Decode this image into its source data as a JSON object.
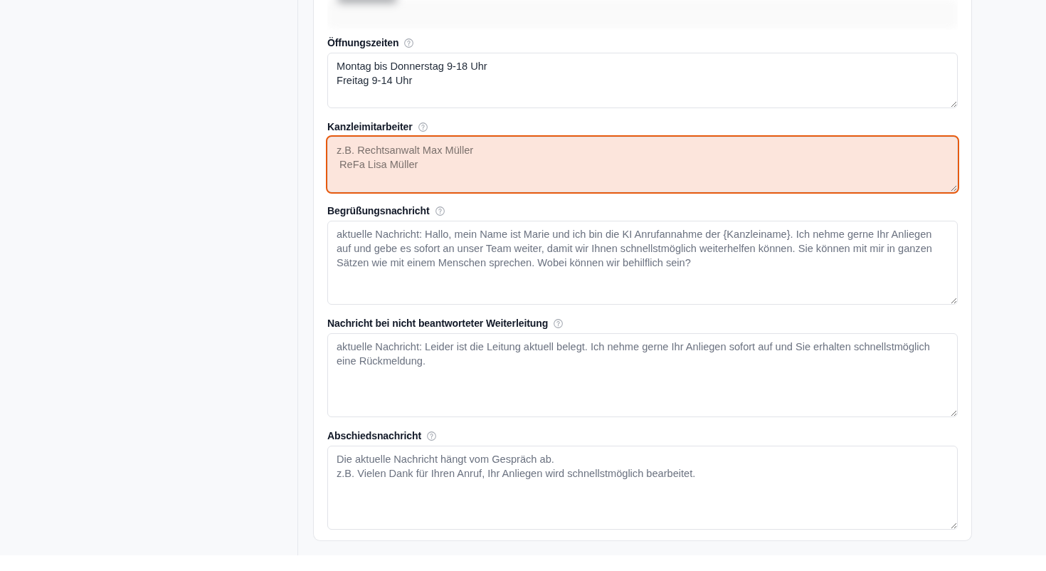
{
  "fields": [
    {
      "label": "Öffnungszeiten",
      "value": "Montag bis Donnerstag 9-18 Uhr\nFreitag 9-14 Uhr",
      "highlighted": false
    },
    {
      "label": "Kanzleimitarbeiter",
      "placeholder": "z.B. Rechtsanwalt Max Müller\n ReFa Lisa Müller",
      "highlighted": true
    },
    {
      "label": "Begrüßungsnachricht",
      "placeholder": "aktuelle Nachricht: Hallo, mein Name ist Marie und ich bin die KI Anrufannahme der {Kanzleiname}. Ich nehme gerne Ihr Anliegen auf und gebe es sofort an unser Team weiter, damit wir Ihnen schnellstmöglich weiterhelfen können. Sie können mit mir in ganzen Sätzen wie mit einem Menschen sprechen. Wobei können wir behilflich sein?",
      "highlighted": false
    },
    {
      "label": "Nachricht bei nicht beantworteter Weiterleitung",
      "placeholder": "aktuelle Nachricht: Leider ist die Leitung aktuell belegt. Ich nehme gerne Ihr Anliegen sofort auf und Sie erhalten schnellstmöglich eine Rückmeldung.",
      "highlighted": false
    },
    {
      "label": "Abschiedsnachricht",
      "placeholder": "Die aktuelle Nachricht hängt vom Gespräch ab.\nz.B. Vielen Dank für Ihren Anruf, Ihr Anliegen wird schnellstmöglich bearbeitet.",
      "highlighted": false
    }
  ]
}
